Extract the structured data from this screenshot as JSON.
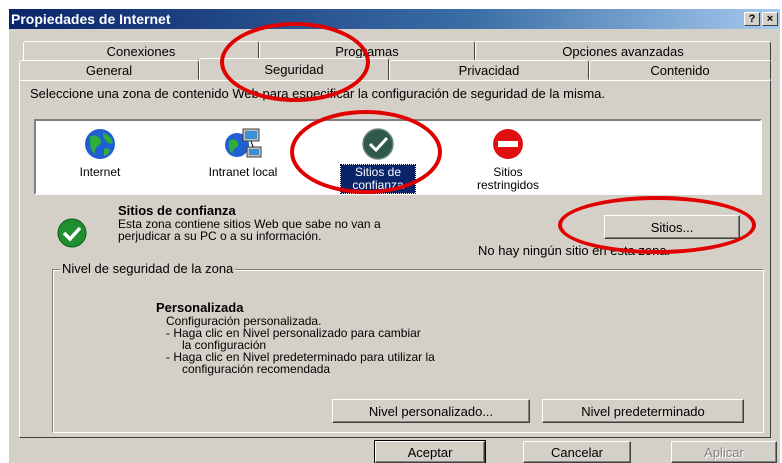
{
  "window": {
    "title": "Propiedades de Internet",
    "help_btn": "?",
    "close_btn": "×"
  },
  "tabs_row1": [
    {
      "label": "Conexiones"
    },
    {
      "label": "Programas"
    },
    {
      "label": "Opciones avanzadas"
    }
  ],
  "tabs_row2": [
    {
      "label": "General"
    },
    {
      "label": "Seguridad",
      "active": true
    },
    {
      "label": "Privacidad"
    },
    {
      "label": "Contenido"
    }
  ],
  "intro": "Seleccione una zona de contenido Web para especificar la configuración de seguridad de la misma.",
  "zones": [
    {
      "label": "Internet",
      "icon": "globe-icon"
    },
    {
      "label": "Intranet local",
      "icon": "network-icon"
    },
    {
      "label": "Sitios de confianza",
      "icon": "check-icon",
      "selected": true
    },
    {
      "label": "Sitios restringidos",
      "icon": "no-entry-icon"
    }
  ],
  "zone_info": {
    "title": "Sitios de confianza",
    "description": "Esta zona contiene sitios Web que sabe no van a perjudicar a su PC o a su información.",
    "sites_button": "Sitios...",
    "no_sites": "No hay ningún sitio en esta zona."
  },
  "level_group": {
    "legend": "Nivel de seguridad de la zona",
    "title": "Personalizada",
    "line1": "Configuración personalizada.",
    "line2": "- Haga clic en Nivel personalizado para cambiar",
    "line2b": "la configuración",
    "line3": "- Haga clic en Nivel predeterminado para utilizar la",
    "line3b": "configuración recomendada",
    "custom_btn": "Nivel personalizado...",
    "default_btn": "Nivel predeterminado"
  },
  "footer": {
    "ok": "Aceptar",
    "cancel": "Cancelar",
    "apply": "Aplicar"
  },
  "colors": {
    "annotation": "#e00000",
    "selection": "#0a246a",
    "face": "#d4d0c8"
  }
}
